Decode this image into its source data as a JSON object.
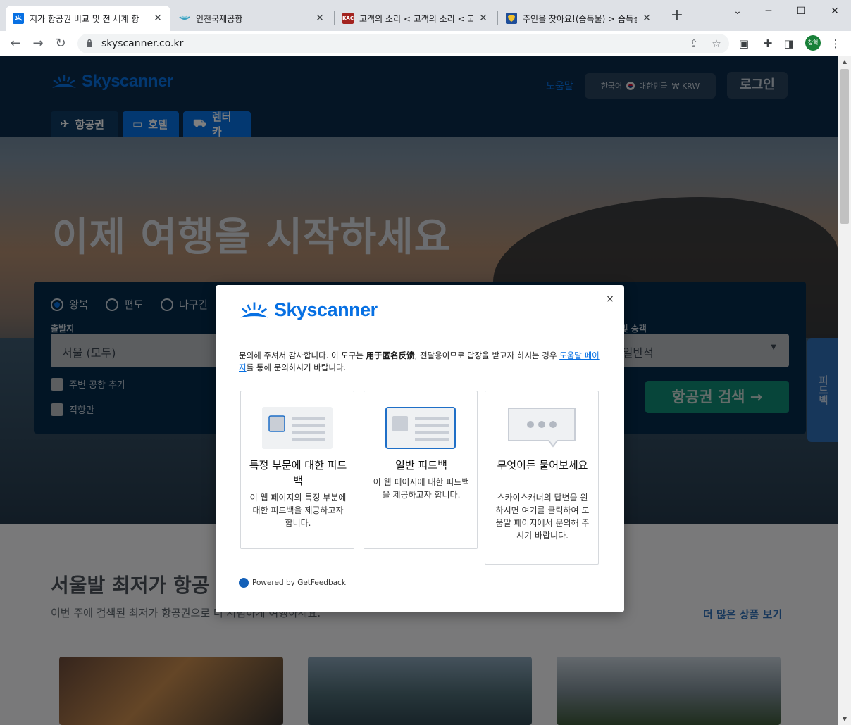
{
  "browser": {
    "tabs": [
      {
        "title": "저가 항공권 비교 및 전 세계 항",
        "active": true
      },
      {
        "title": "인천국제공항",
        "active": false
      },
      {
        "title": "고객의 소리 < 고객의 소리 < 고",
        "active": false
      },
      {
        "title": "주인을 찾아요!(습득물) > 습득물",
        "active": false
      }
    ],
    "url": "skyscanner.co.kr",
    "profile_label": "창혁",
    "tab_favicons": {
      "kac": "KAC"
    }
  },
  "site": {
    "logo_text": "Skyscanner",
    "help_label": "도움말",
    "locale": {
      "language": "한국어",
      "country": "대한민국",
      "currency": "₩ KRW"
    },
    "login_label": "로그인",
    "verticals": [
      {
        "label": "항공권",
        "icon": "plane-icon"
      },
      {
        "label": "호텔",
        "icon": "bed-icon"
      },
      {
        "label": "렌터카",
        "icon": "car-icon"
      }
    ],
    "hero_title": "이제 여행을 시작하세요",
    "search": {
      "trip_types": [
        "왕복",
        "편도",
        "다구간"
      ],
      "origin_label": "출발지",
      "origin_value": "서울 (모두)",
      "cabin_label": "좌석 등급 및 승객",
      "cabin_value": "성인, 일반석",
      "nearby_airports_label": "주변 공항 추가",
      "direct_only_label": "직항만",
      "search_button": "항공권 검색 →"
    },
    "feedback_tab": "피드백",
    "deals_title": "서울발 최저가 항공",
    "deals_subtitle": "이번 주에 검색된 최저가 항공권으로 더 저렴하게 여행하세요.",
    "more_deals_link": "더 많은 상품 보기"
  },
  "modal": {
    "logo_text": "Skyscanner",
    "close_label": "×",
    "description_parts": {
      "before": "문의해 주셔서 감사합니다. 이 도구는 ",
      "bold": "用于匿名反馈",
      "middle": ", 전달용이므로 답장을 받고자 하시는 경우 ",
      "link": "도움말 페이지",
      "after": "를 통해 문의하시기 바랍니다."
    },
    "options": [
      {
        "title": "특정 부문에 대한 피드백",
        "text": "이 웹 페이지의 특정 부분에 대한 피드백을 제공하고자 합니다."
      },
      {
        "title": "일반 피드백",
        "text": "이 웹 페이지에 대한 피드백을 제공하고자 합니다."
      },
      {
        "title": "무엇이든 물어보세요",
        "text": "스카이스캐너의 답변을 원하시면 여기를 클릭하여 도움말 페이지에서 문의해 주시기 바랍니다."
      }
    ],
    "powered_by": "Powered by GetFeedback"
  },
  "colors": {
    "brand_blue": "#0770e3",
    "navy": "#05203c",
    "search_green": "#00a698"
  }
}
